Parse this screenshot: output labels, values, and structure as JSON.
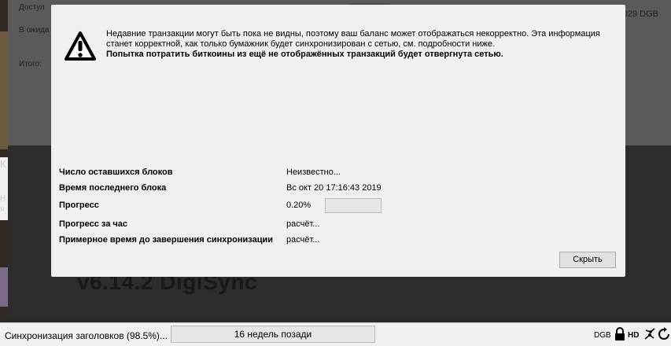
{
  "background": {
    "available_label": "Достул",
    "pending_label": "В ожида",
    "total_label": "Итого:",
    "amount_fragment": "029 DGB",
    "side_letter": "К",
    "side_letter2": "Н",
    "side_letter3": "я",
    "version_text": "v6.14.2 DigiSync"
  },
  "modal": {
    "warning_text": "Недавние транзакции могут быть пока не видны, поэтому ваш баланс может отображаться некорректно. Эта информация станет корректной, как только бумажник будет синхронизирован с сетью, см. подробности ниже.",
    "warning_bold": "Попытка потратить биткоины из ещё не отображённых транзакций будет отвергнута сетью.",
    "rows": [
      {
        "label": "Число оставшихся блоков",
        "value": "Неизвестно..."
      },
      {
        "label": "Время последнего блока",
        "value": "Вс окт 20 17:16:43 2019"
      },
      {
        "label": "Прогресс",
        "value": "0.20%"
      },
      {
        "label": "Прогресс за час",
        "value": "расчёт..."
      },
      {
        "label": "Примерное время до завершения синхронизации",
        "value": "расчёт..."
      }
    ],
    "progress_fraction": 0.002,
    "hide_label": "Скрыть"
  },
  "statusbar": {
    "sync_label": "Синхронизация заголовков (98.5%)...",
    "behind_label": "16 недель позади",
    "unit": "DGB",
    "hd_label": "HD",
    "icons": [
      "lock-icon",
      "hd-icon",
      "network-icon",
      "sync-icon"
    ]
  }
}
